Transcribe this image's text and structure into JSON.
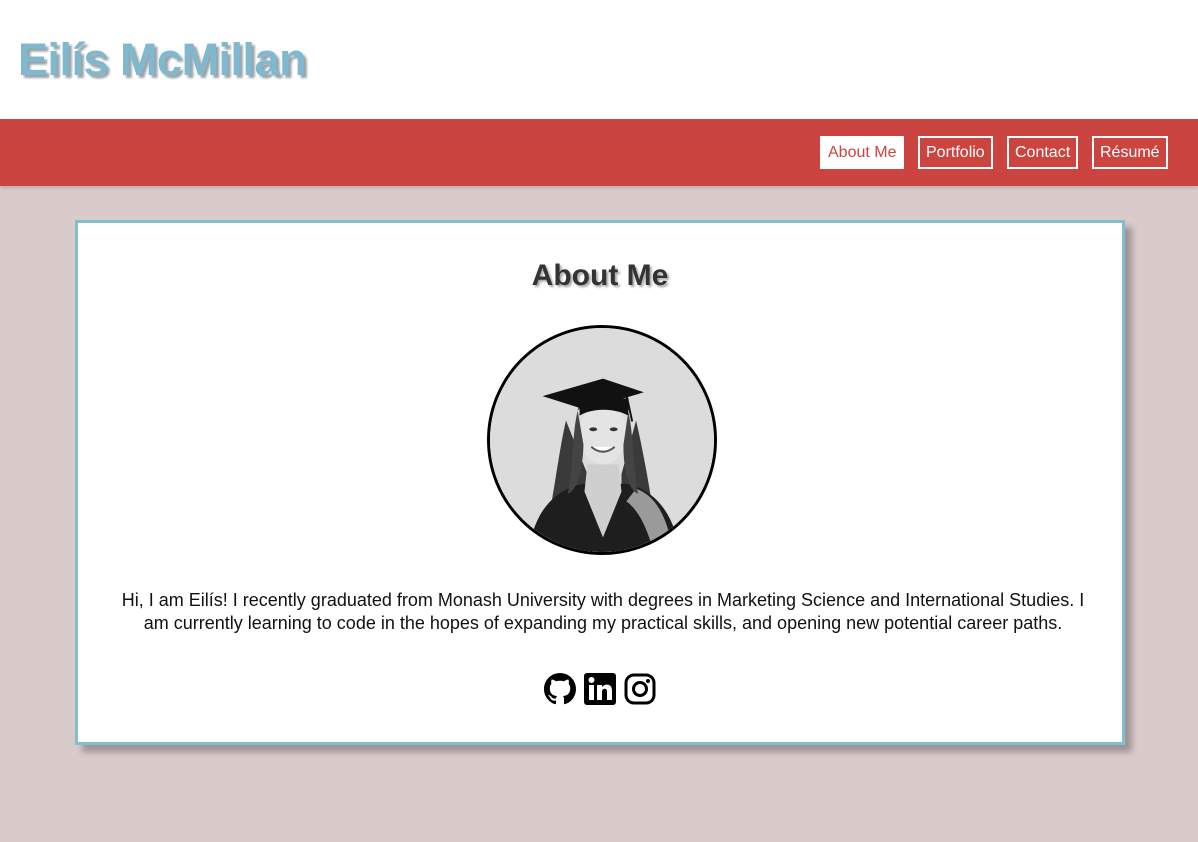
{
  "header": {
    "title": "Eilís McMillan"
  },
  "nav": {
    "items": [
      {
        "label": "About Me",
        "active": true
      },
      {
        "label": "Portfolio",
        "active": false
      },
      {
        "label": "Contact",
        "active": false
      },
      {
        "label": "Résumé",
        "active": false
      }
    ]
  },
  "about": {
    "heading": "About Me",
    "bio": "Hi, I am Eilís! I recently graduated from Monash University with degrees in Marketing Science and International Studies. I am currently learning to code in the hopes of expanding my practical skills, and opening new potential career paths.",
    "photo_icon": "profile-photo",
    "socials": [
      {
        "icon": "github-icon"
      },
      {
        "icon": "linkedin-icon"
      },
      {
        "icon": "instagram-icon"
      }
    ]
  },
  "colors": {
    "title": "#7fb8cf",
    "nav_background": "#cc4440",
    "page_background": "#dacbcb",
    "card_border": "#84bdd1"
  }
}
